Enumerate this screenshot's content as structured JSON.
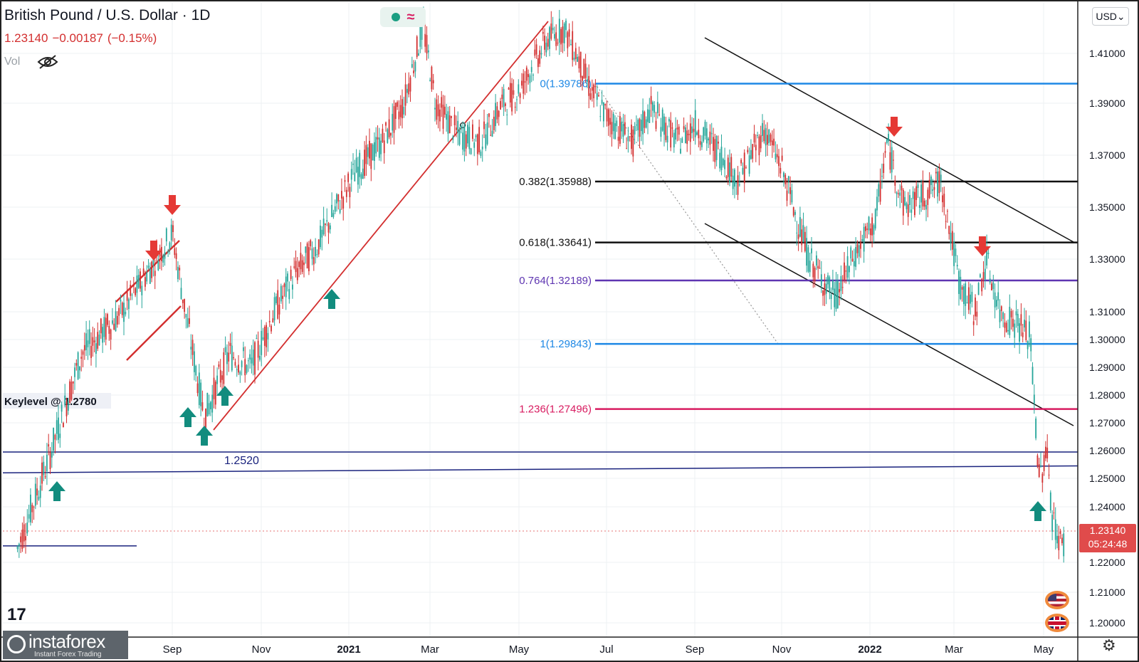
{
  "header": {
    "symbol": "British Pound / U.S. Dollar · 1D",
    "price": "1.23140",
    "change": "−0.00187",
    "change_pct": "(−0.15%)",
    "vol_label": "Vol"
  },
  "currency_selector": "USD",
  "last_price": {
    "price": "1.23140",
    "countdown": "05:24:48"
  },
  "brand": {
    "name": "instaforex",
    "sub": "Instant Forex Trading"
  },
  "colors": {
    "up": "#26a69a",
    "down": "#ef5350",
    "candle": "#d32f2f",
    "fib_blue": "#1e88e5",
    "fib_black": "#111111",
    "fib_purple": "#5e35b1",
    "fib_red": "#d81b60",
    "support": "#1a237e",
    "arrow_up": "#128c7e",
    "arrow_down": "#e53935"
  },
  "chart_data": {
    "type": "line",
    "series": [
      {
        "x": [
          "2020-07-10",
          "2020-07-20",
          "2020-08-01",
          "2020-08-15",
          "2020-09-01",
          "2020-09-10",
          "2020-09-23",
          "2020-10-10",
          "2020-10-25",
          "2020-11-10",
          "2020-11-25",
          "2020-12-10",
          "2021-01-05",
          "2021-01-25",
          "2021-02-10",
          "2021-02-24",
          "2021-03-05",
          "2021-03-20",
          "2021-04-05",
          "2021-04-20",
          "2021-05-01",
          "2021-05-20",
          "2021-06-01",
          "2021-06-10",
          "2021-06-20",
          "2021-07-01",
          "2021-07-20",
          "2021-08-01",
          "2021-08-20",
          "2021-09-01",
          "2021-09-20",
          "2021-10-01",
          "2021-10-20",
          "2021-11-01",
          "2021-11-20",
          "2021-12-08",
          "2021-12-20",
          "2022-01-05",
          "2022-01-13",
          "2022-01-25",
          "2022-02-10",
          "2022-02-20",
          "2022-03-05",
          "2022-03-15",
          "2022-03-23",
          "2022-04-01",
          "2022-04-15",
          "2022-04-22",
          "2022-04-28",
          "2022-05-03",
          "2022-05-06",
          "2022-05-12",
          "2022-05-13"
        ],
        "values": [
          1.225,
          1.255,
          1.295,
          1.31,
          1.34,
          1.31,
          1.272,
          1.295,
          1.29,
          1.31,
          1.325,
          1.335,
          1.363,
          1.375,
          1.39,
          1.421,
          1.39,
          1.378,
          1.375,
          1.39,
          1.395,
          1.415,
          1.42,
          1.41,
          1.395,
          1.385,
          1.375,
          1.388,
          1.375,
          1.382,
          1.37,
          1.36,
          1.38,
          1.365,
          1.33,
          1.315,
          1.33,
          1.345,
          1.375,
          1.35,
          1.355,
          1.36,
          1.32,
          1.31,
          1.33,
          1.31,
          1.305,
          1.3,
          1.25,
          1.26,
          1.235,
          1.225,
          1.2314
        ]
      }
    ],
    "ylim": [
      1.195,
      1.435
    ],
    "x_ticks": [
      "Sep",
      "Nov",
      "2021",
      "Mar",
      "May",
      "Jul",
      "Sep",
      "Nov",
      "2022",
      "Mar",
      "May"
    ],
    "y_ticks": [
      "1.41000",
      "1.39000",
      "1.37000",
      "1.35000",
      "1.33000",
      "1.31000",
      "1.30000",
      "1.29000",
      "1.28000",
      "1.27000",
      "1.26000",
      "1.25000",
      "1.24000",
      "1.23140",
      "1.22000",
      "1.21000",
      "1.20000"
    ],
    "fib_levels": [
      {
        "label": "0(1.39786)",
        "value": 1.39786,
        "color": "#1e88e5"
      },
      {
        "label": "0.382(1.35988)",
        "value": 1.35988,
        "color": "#111111"
      },
      {
        "label": "0.618(1.33641)",
        "value": 1.33641,
        "color": "#111111"
      },
      {
        "label": "0.764(1.32189)",
        "value": 1.32189,
        "color": "#5e35b1"
      },
      {
        "label": "1(1.29843)",
        "value": 1.29843,
        "color": "#1e88e5"
      },
      {
        "label": "1.236(1.27496)",
        "value": 1.27496,
        "color": "#d81b60"
      }
    ],
    "annotations": [
      "Keylevel @ 1.2780",
      "1.2520"
    ],
    "grid": true
  }
}
